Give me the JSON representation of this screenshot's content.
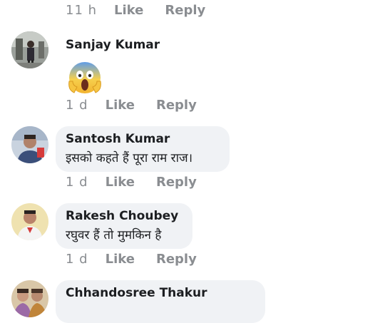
{
  "top_row": {
    "time": "11 h",
    "like": "Like",
    "reply": "Reply"
  },
  "comments": [
    {
      "author": "Sanjay Kumar",
      "text": "",
      "emoji": "face-screaming-in-fear",
      "time": "1 d",
      "like": "Like",
      "reply": "Reply"
    },
    {
      "author": "Santosh Kumar",
      "text": "इसको कहते हैं पूरा राम राज।",
      "time": "1 d",
      "like": "Like",
      "reply": "Reply"
    },
    {
      "author": "Rakesh Choubey",
      "text": "रघुवर हैं तो मुमकिन है",
      "time": "1 d",
      "like": "Like",
      "reply": "Reply"
    },
    {
      "author": "Chhandosree Thakur",
      "text": ""
    }
  ],
  "colors": {
    "bubble_bg": "#f0f2f5",
    "meta_text": "#8a8d91",
    "name_text": "#1c1e21"
  }
}
